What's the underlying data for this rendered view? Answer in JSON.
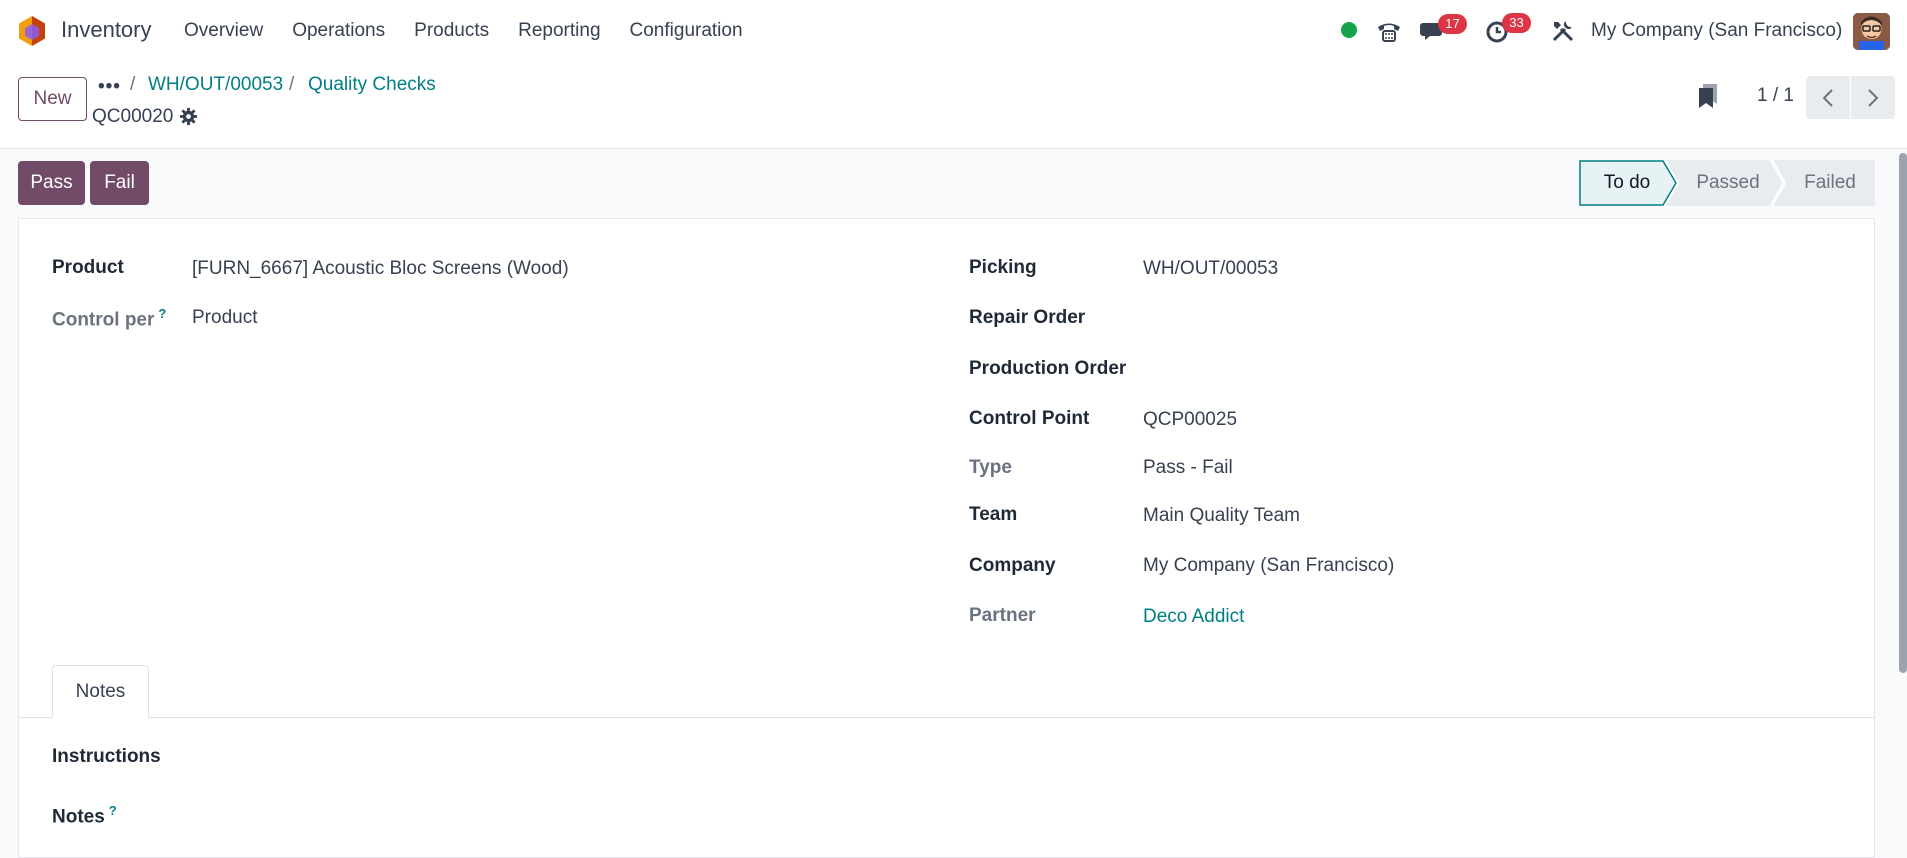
{
  "navbar": {
    "app_name": "Inventory",
    "menu": [
      "Overview",
      "Operations",
      "Products",
      "Reporting",
      "Configuration"
    ],
    "messages_count": "17",
    "activities_count": "33",
    "company": "My Company (San Francisco)",
    "presence_color": "#16a34a"
  },
  "control": {
    "new_label": "New",
    "more_label": "•••",
    "breadcrumbs": [
      "WH/OUT/00053",
      "Quality Checks"
    ],
    "record_name": "QC00020",
    "pager": "1 / 1"
  },
  "actions": {
    "pass_label": "Pass",
    "fail_label": "Fail"
  },
  "status": {
    "stages": [
      "To do",
      "Passed",
      "Failed"
    ],
    "current": "To do"
  },
  "form": {
    "left": [
      {
        "label": "Product",
        "value": "[FURN_6667] Acoustic Bloc Screens (Wood)"
      },
      {
        "label": "Control per",
        "value": "Product"
      }
    ],
    "right": [
      {
        "label": "Picking",
        "value": "WH/OUT/00053"
      },
      {
        "label": "Repair Order",
        "value": ""
      },
      {
        "label": "Production Order",
        "value": ""
      },
      {
        "label": "Control Point",
        "value": "QCP00025"
      },
      {
        "label": "Type",
        "value": "Pass - Fail"
      },
      {
        "label": "Team",
        "value": "Main Quality Team"
      },
      {
        "label": "Company",
        "value": "My Company (San Francisco)"
      },
      {
        "label": "Partner",
        "value": "Deco Addict"
      }
    ],
    "help_mark": "?"
  },
  "notebook": {
    "tab_label": "Notes",
    "instructions_label": "Instructions",
    "notes_label": "Notes"
  },
  "colors": {
    "primary": "#714b67",
    "link": "#017e84",
    "badge": "#dc3545"
  }
}
